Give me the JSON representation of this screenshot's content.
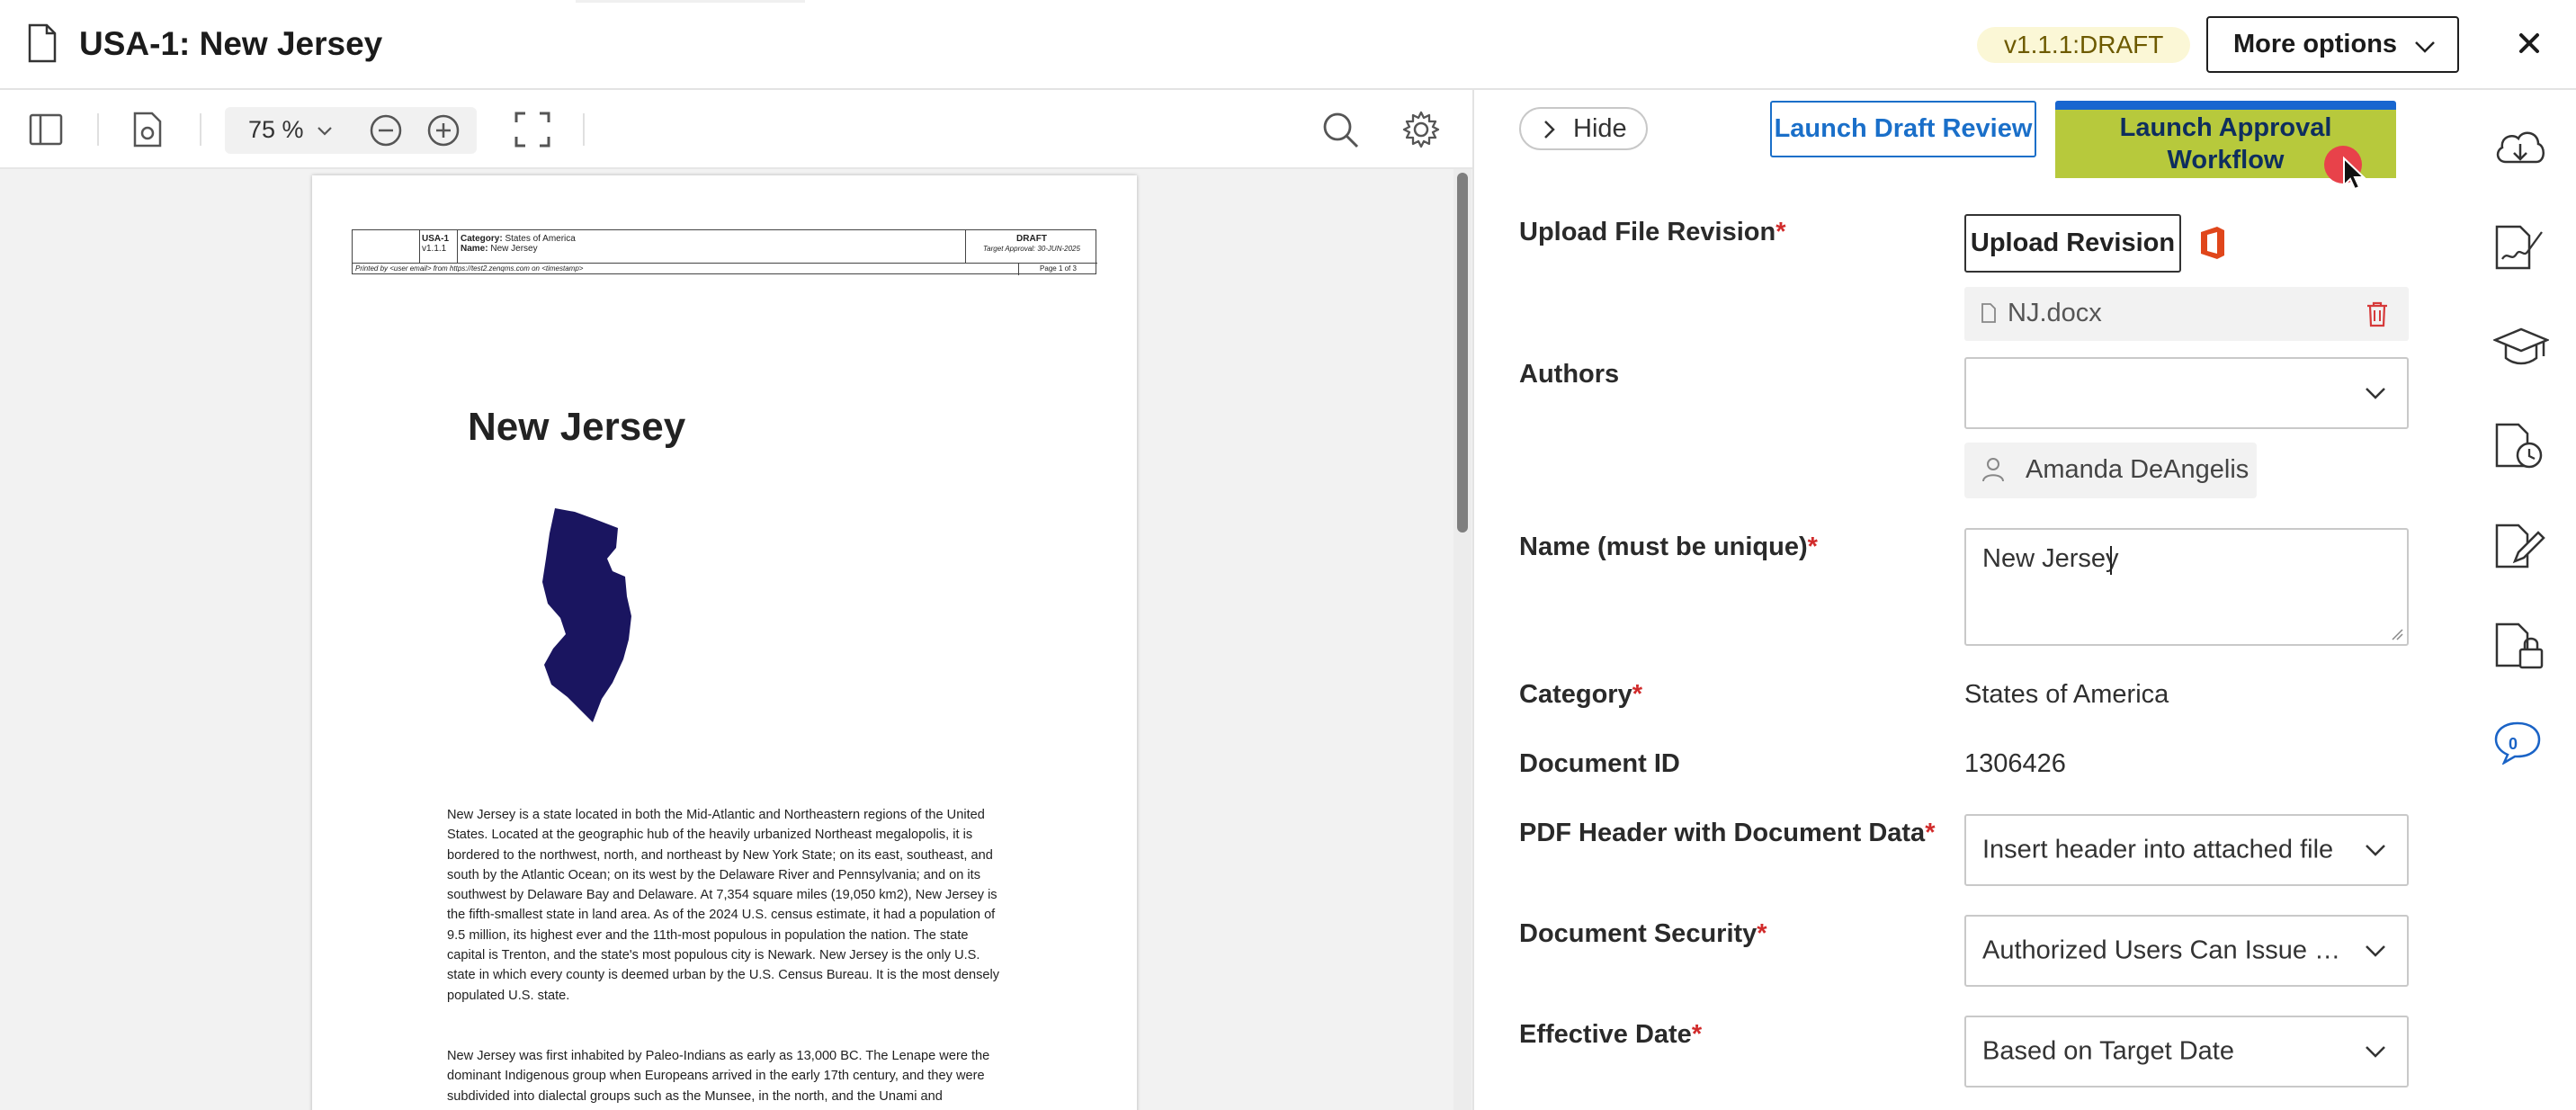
{
  "header": {
    "title": "USA-1: New Jersey",
    "version_badge": "v1.1.1:DRAFT",
    "more_options_label": "More options"
  },
  "viewer_toolbar": {
    "zoom_value": "75 %"
  },
  "document_preview": {
    "header_table": {
      "doc_id": "USA-1",
      "version": "v1.1.1",
      "category_label": "Category:",
      "category_value": "States of America",
      "name_label": "Name:",
      "name_value": "New Jersey",
      "status": "DRAFT",
      "target_approval": "Target Approval: 30-JUN-2025",
      "printed_by": "Printed by <user email> from https://test2.zenqms.com on <timestamp>",
      "page": "Page 1 of 3"
    },
    "heading": "New Jersey",
    "paragraphs": [
      "New Jersey is a state located in both the Mid-Atlantic and Northeastern regions of the United States. Located at the geographic hub of the heavily urbanized Northeast megalopolis, it is bordered to the northwest, north, and northeast by New York State; on its east, southeast, and south by the Atlantic Ocean; on its west by the Delaware River and Pennsylvania; and on its southwest by Delaware Bay and Delaware. At 7,354 square miles (19,050 km2), New Jersey is the fifth-smallest state in land area. As of the 2024 U.S. census estimate, it had a population of 9.5 million, its highest ever and the 11th-most populous in population the nation. The state capital is Trenton, and the state's most populous city is Newark. New Jersey is the only U.S. state in which every county is deemed urban by the U.S. Census Bureau. It is the most densely populated U.S. state.",
      "New Jersey was first inhabited by Paleo-Indians as early as 13,000 BC. The Lenape were the dominant Indigenous group when Europeans arrived in the early 17th century, and they were subdivided into dialectal groups such as the Munsee, in the north, and the Unami and"
    ]
  },
  "form": {
    "hide_label": "Hide",
    "draft_review_label": "Launch Draft Review",
    "approval_label": "Launch Approval Workflow",
    "upload_label": "Upload File Revision",
    "upload_button": "Upload Revision",
    "file_name": "NJ.docx",
    "authors_label": "Authors",
    "author_name": "Amanda DeAngelis",
    "name_label": "Name (must be unique)",
    "name_value": "New Jersey",
    "category_label": "Category",
    "category_value": "States of America",
    "docid_label": "Document ID",
    "docid_value": "1306426",
    "pdf_header_label": "PDF Header with Document Data",
    "pdf_header_value": "Insert header into attached file",
    "security_label": "Document Security",
    "security_value": "Authorized Users Can Issue Co...",
    "effective_label": "Effective Date",
    "effective_value": "Based on Target Date",
    "required_mark": "*"
  },
  "rail": {
    "comments_count": "0"
  },
  "colors": {
    "primary": "#1866cf",
    "required": "#d12b2b",
    "badge_bg": "#fbf7d6",
    "map_fill": "#1a1560"
  }
}
